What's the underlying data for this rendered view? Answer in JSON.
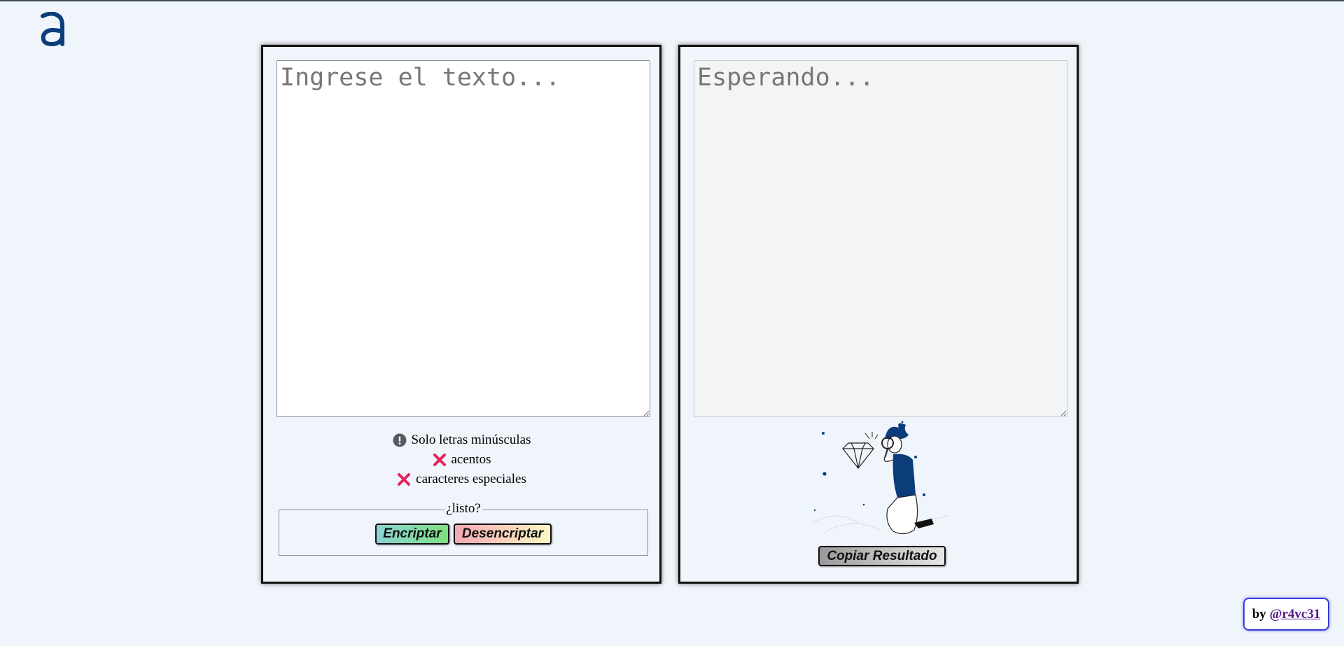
{
  "logo": {
    "alt": "Alura logo"
  },
  "input": {
    "placeholder": "Ingrese el texto..."
  },
  "output": {
    "placeholder": "Esperando..."
  },
  "notes": [
    {
      "icon": "info-circle-icon",
      "text": "Solo letras minúsculas"
    },
    {
      "icon": "x-icon",
      "text": "acentos"
    },
    {
      "icon": "x-icon",
      "text": "caracteres especiales"
    }
  ],
  "actions": {
    "legend": "¿listo?",
    "encrypt_label": "Encriptar",
    "decrypt_label": "Desencriptar"
  },
  "copy_label": "Copiar Resultado",
  "credit": {
    "prefix": "by",
    "handle": "@r4vc31"
  },
  "colors": {
    "background": "#f0f4fb",
    "brand": "#0b3d7b",
    "x_mark": "#e5245d"
  }
}
